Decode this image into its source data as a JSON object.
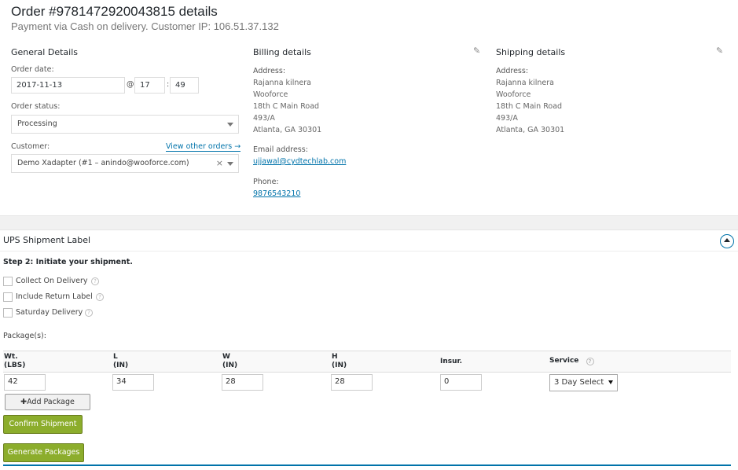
{
  "header": {
    "title": "Order #9781472920043815 details",
    "subtitle": "Payment via Cash on delivery. Customer IP: 106.51.37.132"
  },
  "general": {
    "title": "General Details",
    "order_date_label": "Order date:",
    "order_date": "2017-11-13",
    "at_sign": "@",
    "hour": "17",
    "minute": "49",
    "time_sep": ":",
    "status_label": "Order status:",
    "status": "Processing",
    "customer_label": "Customer:",
    "view_orders": "View other orders →",
    "customer": "Demo Xadapter (#1 – anindo@wooforce.com)",
    "clear_glyph": "×"
  },
  "billing": {
    "title": "Billing details",
    "address_label": "Address:",
    "address_lines": [
      "Rajanna kilnera",
      "Wooforce",
      "18th C Main Road",
      "493/A",
      "Atlanta, GA 30301"
    ],
    "email_label": "Email address:",
    "email": "ujjawal@cydtechlab.com",
    "phone_label": "Phone:",
    "phone": "9876543210"
  },
  "shipping": {
    "title": "Shipping details",
    "address_label": "Address:",
    "address_lines": [
      "Rajanna kilnera",
      "Wooforce",
      "18th C Main Road",
      "493/A",
      "Atlanta, GA 30301"
    ]
  },
  "ups": {
    "title": "UPS Shipment Label",
    "step": "Step 2: Initiate your shipment.",
    "options": [
      "Collect On Delivery",
      "Include Return Label",
      "Saturday Delivery"
    ],
    "help_glyph": "?",
    "packages_label": "Package(s):",
    "columns": {
      "wt": "Wt.",
      "wt_unit": "(LBS)",
      "l": "L",
      "l_unit": "(IN)",
      "w": "W",
      "w_unit": "(IN)",
      "h": "H",
      "h_unit": "(IN)",
      "insur": "Insur.",
      "service": "Service"
    },
    "package": {
      "wt": "42",
      "l": "34",
      "w": "28",
      "h": "28",
      "insur": "0",
      "service": "3 Day Select"
    },
    "add_package": "✚Add Package",
    "confirm": "Confirm Shipment",
    "generate": "Generate Packages"
  },
  "icons": {
    "pencil": "✎"
  },
  "colors": {
    "link": "#0073aa",
    "green_button": "#8cad2c"
  }
}
